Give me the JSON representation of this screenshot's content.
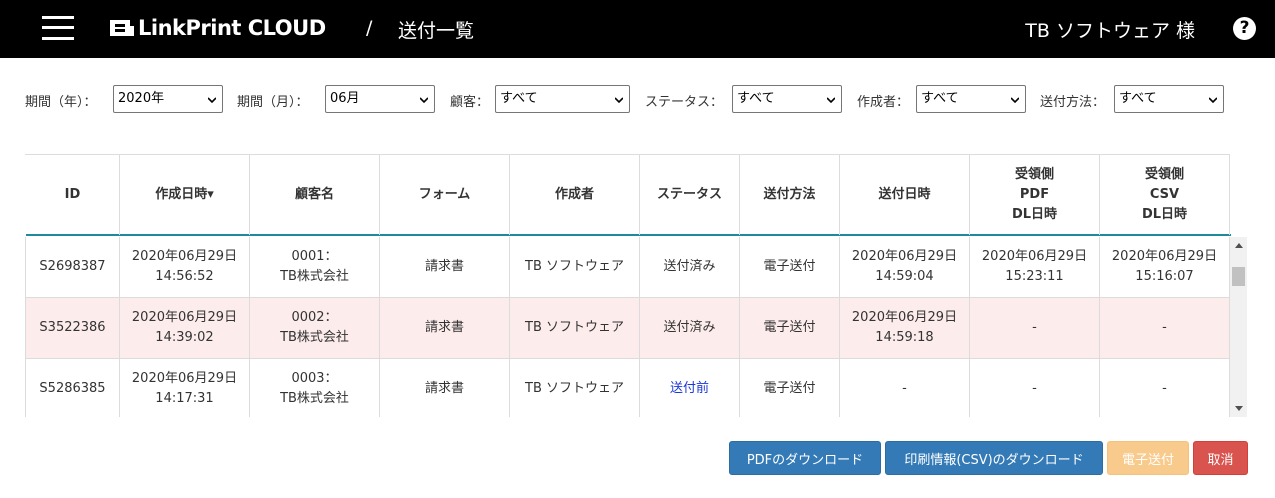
{
  "header": {
    "logo_text": "LinkPrint CLOUD",
    "separator": "/",
    "page_title": "送付一覧",
    "user_name": "TB ソフトウェア 様",
    "help_glyph": "?"
  },
  "filters": [
    {
      "label": "期間（年）：",
      "value": "2020年"
    },
    {
      "label": "期間（月）：",
      "value": "06月"
    },
    {
      "label": "顧客：",
      "value": "すべて"
    },
    {
      "label": "ステータス：",
      "value": "すべて"
    },
    {
      "label": "作成者：",
      "value": "すべて"
    },
    {
      "label": "送付方法：",
      "value": "すべて"
    }
  ],
  "table": {
    "columns": [
      "ID",
      "作成日時▾",
      "顧客名",
      "フォーム",
      "作成者",
      "ステータス",
      "送付方法",
      "送付日時",
      "受領側\nPDF\nDL日時",
      "受領側\nCSV\nDL日時"
    ],
    "rows": [
      [
        "S2698387",
        "2020年06月29日\n14:56:52",
        "0001：\nTB株式会社",
        "請求書",
        "TB ソフトウェア",
        "送付済み",
        "電子送付",
        "2020年06月29日\n14:59:04",
        "2020年06月29日\n15:23:11",
        "2020年06月29日\n15:16:07"
      ],
      [
        "S3522386",
        "2020年06月29日\n14:39:02",
        "0002：\nTB株式会社",
        "請求書",
        "TB ソフトウェア",
        "送付済み",
        "電子送付",
        "2020年06月29日\n14:59:18",
        "-",
        "-"
      ],
      [
        "S5286385",
        "2020年06月29日\n14:17:31",
        "0003：\nTB株式会社",
        "請求書",
        "TB ソフトウェア",
        "送付前",
        "電子送付",
        "-",
        "-",
        "-"
      ]
    ],
    "highlight_row": 1,
    "status_pending_color": "#1a37d8"
  },
  "buttons": {
    "pdf_download": "PDFのダウンロード",
    "csv_download": "印刷情報(CSV)のダウンロード",
    "e_send": "電子送付",
    "cancel": "取消"
  },
  "colors": {
    "header_bg": "#000000",
    "accent_line": "#1f8a9c",
    "row_highlight": "#fdecec",
    "btn_primary": "#337ab7",
    "btn_disabled": "#f8cb8c",
    "btn_danger": "#d9534f"
  }
}
